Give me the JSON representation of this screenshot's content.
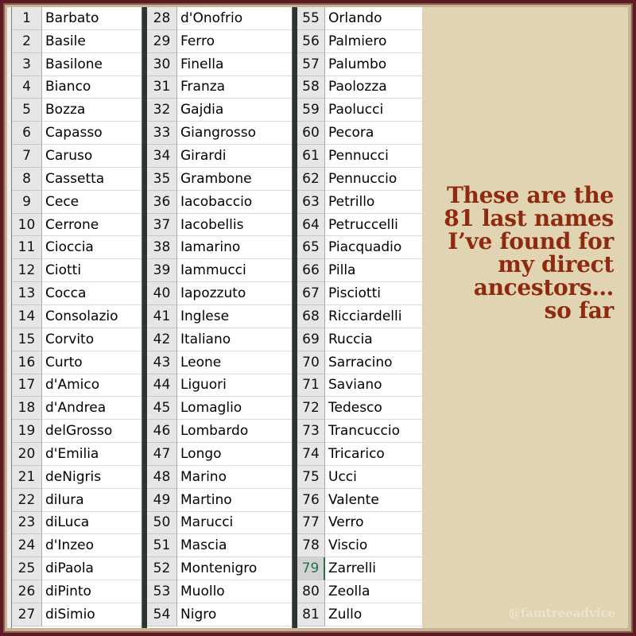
{
  "title_caption": {
    "lines": [
      "These are the",
      "81 last names",
      "I’ve found for",
      "my direct",
      "ancestors…",
      "so far"
    ]
  },
  "watermark": "@famtreeadvice",
  "selected_row": 79,
  "colors": {
    "frame": "#5b1c22",
    "panel_background": "#e1d4b3",
    "caption_text": "#8e2a10",
    "selected_row_number": "#217346"
  },
  "columns": [
    {
      "rows": [
        {
          "n": "1",
          "name": "Barbato"
        },
        {
          "n": "2",
          "name": "Basile"
        },
        {
          "n": "3",
          "name": "Basilone"
        },
        {
          "n": "4",
          "name": "Bianco"
        },
        {
          "n": "5",
          "name": "Bozza"
        },
        {
          "n": "6",
          "name": "Capasso"
        },
        {
          "n": "7",
          "name": "Caruso"
        },
        {
          "n": "8",
          "name": "Cassetta"
        },
        {
          "n": "9",
          "name": "Cece"
        },
        {
          "n": "10",
          "name": "Cerrone"
        },
        {
          "n": "11",
          "name": "Cioccia"
        },
        {
          "n": "12",
          "name": "Ciotti"
        },
        {
          "n": "13",
          "name": "Cocca"
        },
        {
          "n": "14",
          "name": "Consolazio"
        },
        {
          "n": "15",
          "name": "Corvito"
        },
        {
          "n": "16",
          "name": "Curto"
        },
        {
          "n": "17",
          "name": "d'Amico"
        },
        {
          "n": "18",
          "name": "d'Andrea"
        },
        {
          "n": "19",
          "name": "delGrosso"
        },
        {
          "n": "20",
          "name": "d'Emilia"
        },
        {
          "n": "21",
          "name": "deNigris"
        },
        {
          "n": "22",
          "name": "diIura"
        },
        {
          "n": "23",
          "name": "diLuca"
        },
        {
          "n": "24",
          "name": "d'Inzeo"
        },
        {
          "n": "25",
          "name": "diPaola"
        },
        {
          "n": "26",
          "name": "diPinto"
        },
        {
          "n": "27",
          "name": "diSimio"
        }
      ]
    },
    {
      "rows": [
        {
          "n": "28",
          "name": "d'Onofrio"
        },
        {
          "n": "29",
          "name": "Ferro"
        },
        {
          "n": "30",
          "name": "Finella"
        },
        {
          "n": "31",
          "name": "Franza"
        },
        {
          "n": "32",
          "name": "Gajdia"
        },
        {
          "n": "33",
          "name": "Giangrosso"
        },
        {
          "n": "34",
          "name": "Girardi"
        },
        {
          "n": "35",
          "name": "Grambone"
        },
        {
          "n": "36",
          "name": "Iacobaccio"
        },
        {
          "n": "37",
          "name": "Iacobellis"
        },
        {
          "n": "38",
          "name": "Iamarino"
        },
        {
          "n": "39",
          "name": "Iammucci"
        },
        {
          "n": "40",
          "name": "Iapozzuto"
        },
        {
          "n": "41",
          "name": "Inglese"
        },
        {
          "n": "42",
          "name": "Italiano"
        },
        {
          "n": "43",
          "name": "Leone"
        },
        {
          "n": "44",
          "name": "Liguori"
        },
        {
          "n": "45",
          "name": "Lomaglio"
        },
        {
          "n": "46",
          "name": "Lombardo"
        },
        {
          "n": "47",
          "name": "Longo"
        },
        {
          "n": "48",
          "name": "Marino"
        },
        {
          "n": "49",
          "name": "Martino"
        },
        {
          "n": "50",
          "name": "Marucci"
        },
        {
          "n": "51",
          "name": "Mascia"
        },
        {
          "n": "52",
          "name": "Montenigro"
        },
        {
          "n": "53",
          "name": "Muollo"
        },
        {
          "n": "54",
          "name": "Nigro"
        }
      ]
    },
    {
      "rows": [
        {
          "n": "55",
          "name": "Orlando"
        },
        {
          "n": "56",
          "name": "Palmiero"
        },
        {
          "n": "57",
          "name": "Palumbo"
        },
        {
          "n": "58",
          "name": "Paolozza"
        },
        {
          "n": "59",
          "name": "Paolucci"
        },
        {
          "n": "60",
          "name": "Pecora"
        },
        {
          "n": "61",
          "name": "Pennucci"
        },
        {
          "n": "62",
          "name": "Pennuccio"
        },
        {
          "n": "63",
          "name": "Petrillo"
        },
        {
          "n": "64",
          "name": "Petruccelli"
        },
        {
          "n": "65",
          "name": "Piacquadio"
        },
        {
          "n": "66",
          "name": "Pilla"
        },
        {
          "n": "67",
          "name": "Pisciotti"
        },
        {
          "n": "68",
          "name": "Ricciardelli"
        },
        {
          "n": "69",
          "name": "Ruccia"
        },
        {
          "n": "70",
          "name": "Sarracino"
        },
        {
          "n": "71",
          "name": "Saviano"
        },
        {
          "n": "72",
          "name": "Tedesco"
        },
        {
          "n": "73",
          "name": "Trancuccio"
        },
        {
          "n": "74",
          "name": "Tricarico"
        },
        {
          "n": "75",
          "name": "Ucci"
        },
        {
          "n": "76",
          "name": "Valente"
        },
        {
          "n": "77",
          "name": "Verro"
        },
        {
          "n": "78",
          "name": "Viscio"
        },
        {
          "n": "79",
          "name": "Zarrelli"
        },
        {
          "n": "80",
          "name": "Zeolla"
        },
        {
          "n": "81",
          "name": "Zullo"
        }
      ]
    }
  ]
}
